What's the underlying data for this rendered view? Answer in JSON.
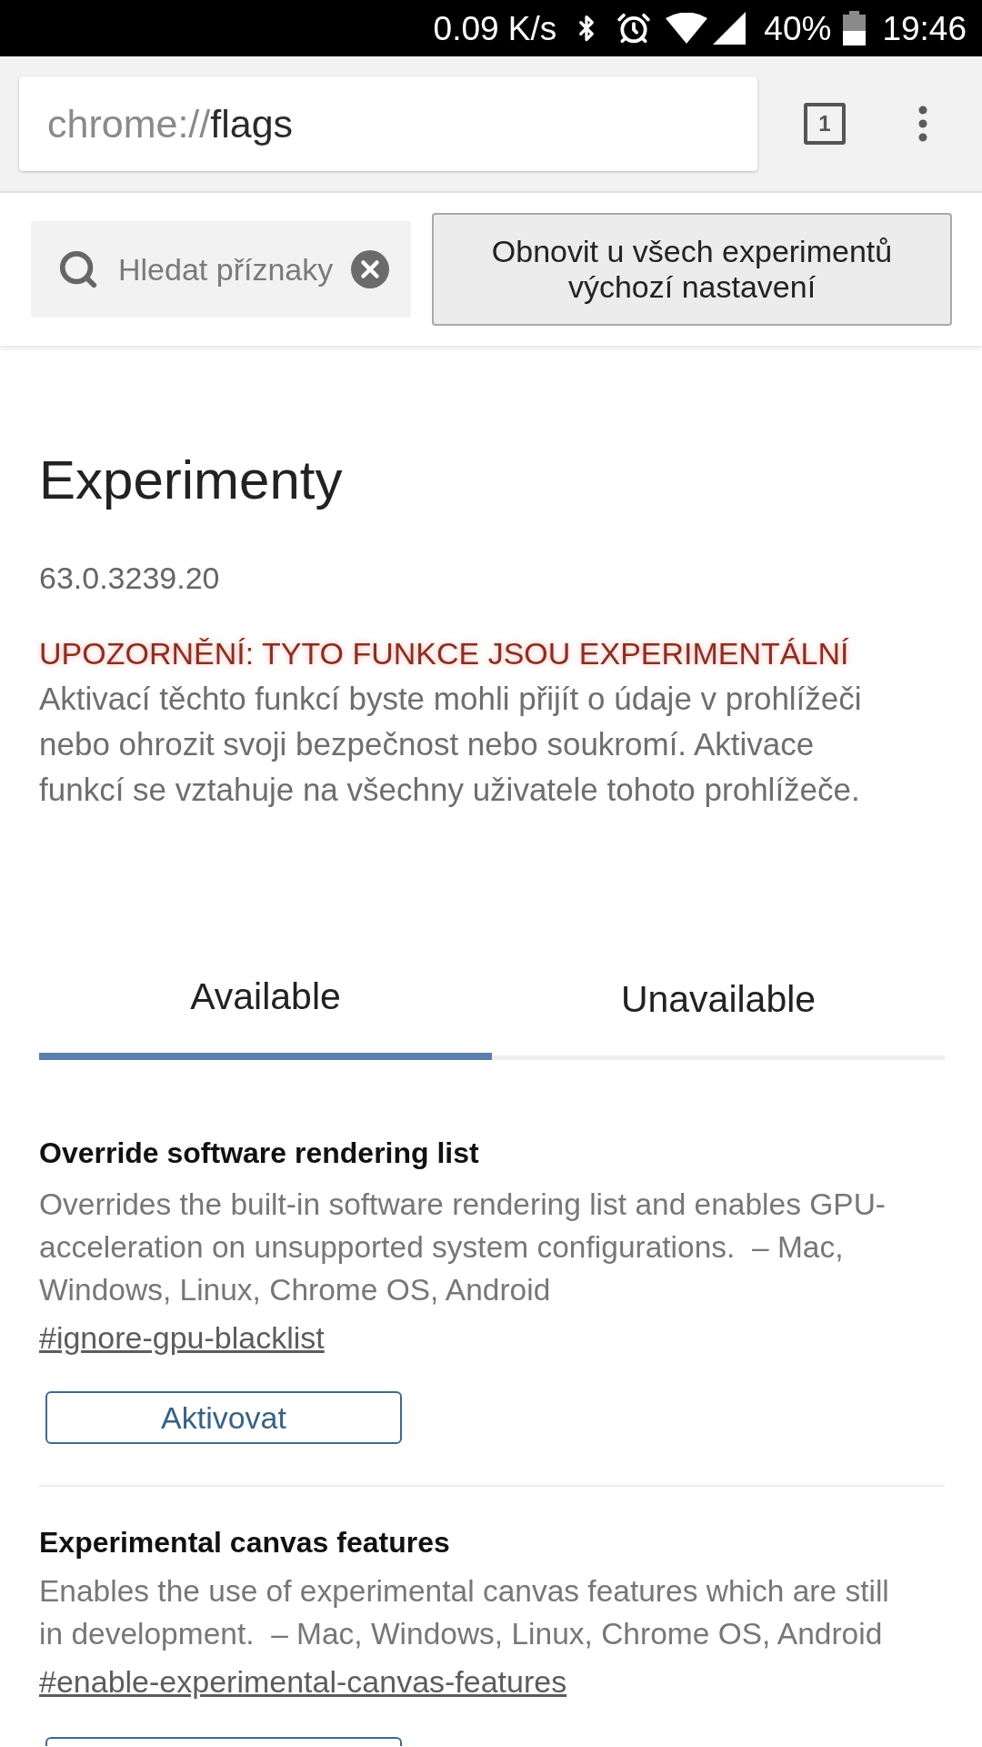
{
  "status_bar": {
    "net_speed": "0.09 K/s",
    "battery": "40%",
    "time": "19:46"
  },
  "toolbar": {
    "url_scheme": "chrome://",
    "url_path": "flags",
    "tab_count": "1"
  },
  "search": {
    "placeholder": "Hledat příznaky"
  },
  "reset_button": {
    "label": "Obnovit u všech experimentů výchozí nastavení"
  },
  "page": {
    "title": "Experimenty",
    "version": "63.0.3239.20",
    "warning": "UPOZORNĚNÍ: TYTO FUNKCE JSOU EXPERIMENTÁLNÍ",
    "warning_text": "Aktivací těchto funkcí byste mohli přijít o údaje v prohlížeči nebo ohrozit svoji bezpečnost nebo soukromí. Aktivace funkcí se vztahuje na všechny uživatele tohoto prohlížeče."
  },
  "tabs": [
    {
      "label": "Available",
      "selected": true
    },
    {
      "label": "Unavailable",
      "selected": false
    }
  ],
  "flags": [
    {
      "title": "Override software rendering list",
      "description": "Overrides the built-in software rendering list and enables GPU-acceleration on unsupported system configurations.  – Mac, Windows, Linux, Chrome OS, Android",
      "link": "#ignore-gpu-blacklist",
      "button": "Aktivovat"
    },
    {
      "title": "Experimental canvas features",
      "description": "Enables the use of experimental canvas features which are still in development.  – Mac, Windows, Linux, Chrome OS, Android",
      "link": "#enable-experimental-canvas-features"
    }
  ]
}
